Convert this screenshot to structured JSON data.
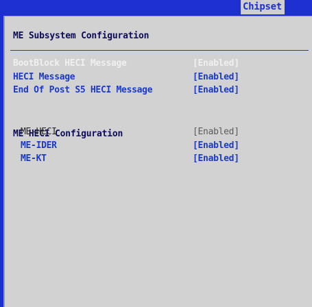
{
  "header": {
    "tab_label": "Chipset"
  },
  "panel": {
    "title": "ME Subsystem Configuration",
    "items": [
      {
        "label": "BootBlock HECI Message",
        "value": "[Enabled]"
      },
      {
        "label": "HECI Message",
        "value": "[Enabled]"
      },
      {
        "label": "End Of Post S5 HECI Message",
        "value": "[Enabled]"
      }
    ],
    "section_title": "ME HECI Configuration",
    "sub_items": [
      {
        "label": "ME-HECI",
        "value": "[Enabled]"
      },
      {
        "label": "ME-IDER",
        "value": "[Enabled]"
      },
      {
        "label": "ME-KT",
        "value": "[Enabled]"
      }
    ]
  },
  "colors": {
    "bios_blue": "#1c2fd0",
    "panel_grey": "#d2d2d2",
    "text_blue": "#1b3ac8",
    "text_dark": "#0b0b5a"
  }
}
